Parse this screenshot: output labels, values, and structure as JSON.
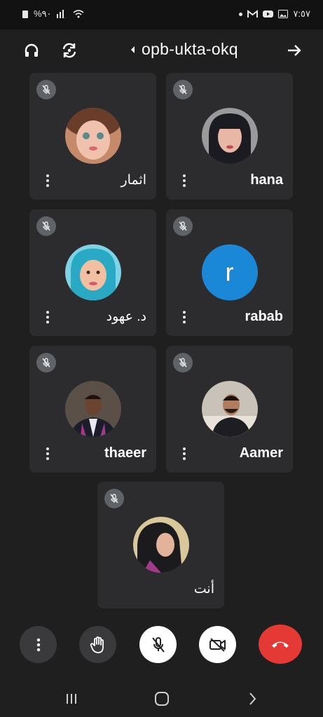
{
  "status_bar": {
    "battery": "%٩٠",
    "time": "٧:٥٧"
  },
  "header": {
    "meeting_code": "opb-ukta-okq"
  },
  "participants": [
    {
      "name": "اثمار",
      "avatar": "photo",
      "muted": true
    },
    {
      "name": "hana",
      "avatar": "photo",
      "muted": true
    },
    {
      "name": "د. عهود",
      "avatar": "photo",
      "muted": true
    },
    {
      "name": "rabab",
      "avatar": "letter",
      "initial": "r",
      "avatar_color": "#1a88d6",
      "muted": true
    },
    {
      "name": "thaeer",
      "avatar": "photo",
      "muted": true
    },
    {
      "name": "Aamer",
      "avatar": "photo",
      "muted": true
    },
    {
      "name": "أنت",
      "avatar": "photo",
      "muted": true
    }
  ],
  "controls": {
    "hangup_color": "#e53935"
  }
}
